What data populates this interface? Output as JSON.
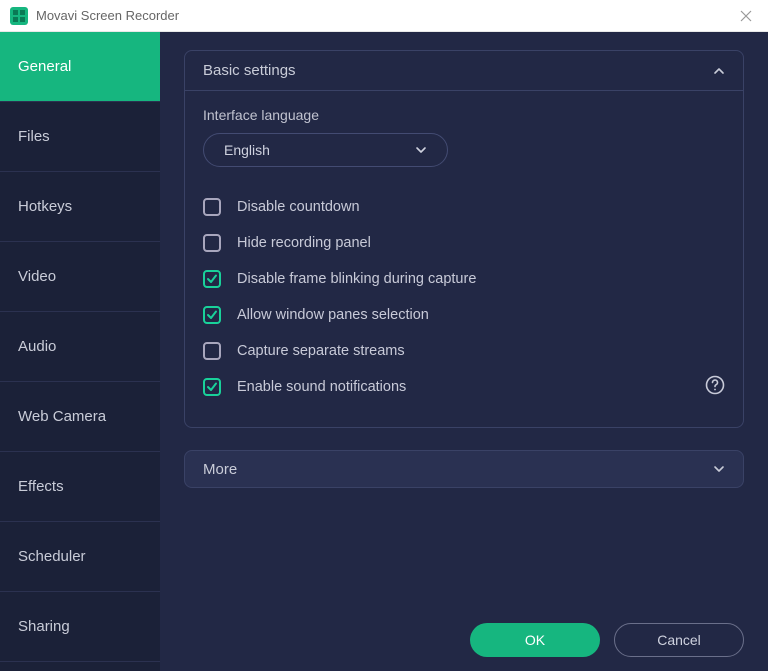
{
  "window": {
    "title": "Movavi Screen Recorder"
  },
  "sidebar": {
    "items": [
      {
        "label": "General",
        "active": true
      },
      {
        "label": "Files",
        "active": false
      },
      {
        "label": "Hotkeys",
        "active": false
      },
      {
        "label": "Video",
        "active": false
      },
      {
        "label": "Audio",
        "active": false
      },
      {
        "label": "Web Camera",
        "active": false
      },
      {
        "label": "Effects",
        "active": false
      },
      {
        "label": "Scheduler",
        "active": false
      },
      {
        "label": "Sharing",
        "active": false
      }
    ]
  },
  "panel": {
    "basic": {
      "title": "Basic settings",
      "expanded": true,
      "language_label": "Interface language",
      "language_value": "English",
      "checkboxes": [
        {
          "label": "Disable countdown",
          "checked": false
        },
        {
          "label": "Hide recording panel",
          "checked": false
        },
        {
          "label": "Disable frame blinking during capture",
          "checked": true
        },
        {
          "label": "Allow window panes selection",
          "checked": true
        },
        {
          "label": "Capture separate streams",
          "checked": false
        },
        {
          "label": "Enable sound notifications",
          "checked": true,
          "help": true
        }
      ]
    },
    "more": {
      "title": "More",
      "expanded": false
    }
  },
  "buttons": {
    "ok": "OK",
    "cancel": "Cancel"
  },
  "colors": {
    "accent": "#16b67f",
    "bg_dark": "#222845",
    "bg_darker": "#1b2138",
    "border": "#3a4266"
  }
}
